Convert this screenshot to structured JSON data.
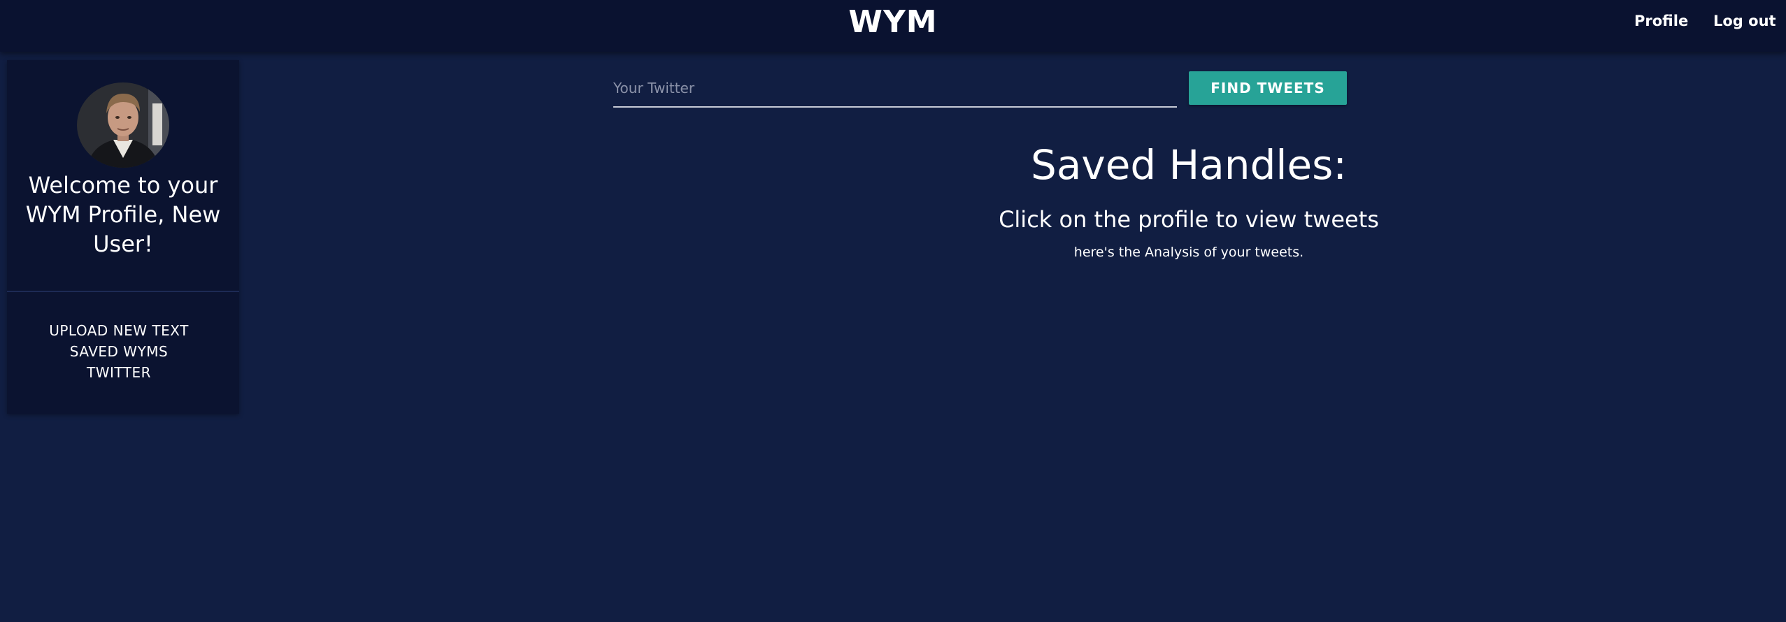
{
  "header": {
    "brand": "WYM",
    "nav": {
      "profile": "Profile",
      "logout": "Log out"
    }
  },
  "sidebar": {
    "welcome": "Welcome to your WYM Profile, New User!",
    "menu": [
      "UPLOAD NEW TEXT",
      "SAVED WYMS",
      "TWITTER"
    ]
  },
  "search": {
    "placeholder": "Your Twitter",
    "value": "",
    "button_label": "FIND TWEETS"
  },
  "main": {
    "title": "Saved Handles:",
    "subtitle": "Click on the profile to view tweets",
    "note": "here's the Analysis of your tweets."
  },
  "colors": {
    "background": "#111e42",
    "header": "#0a1230",
    "panel": "#0b1330",
    "accent": "#27a397"
  }
}
